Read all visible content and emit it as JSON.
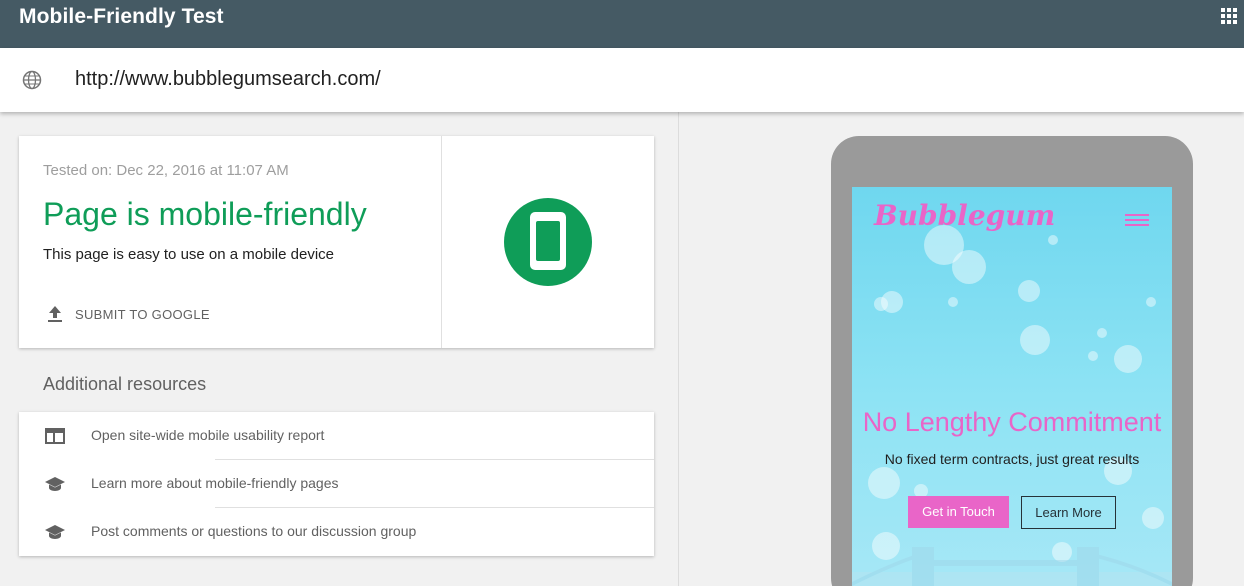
{
  "header": {
    "title": "Mobile-Friendly Test",
    "apps_icon": "apps-grid-icon"
  },
  "urlbar": {
    "icon": "globe-icon",
    "url": "http://www.bubblegumsearch.com/"
  },
  "result": {
    "tested_on": "Tested on: Dec 22, 2016 at 11:07 AM",
    "verdict": "Page is mobile-friendly",
    "subtitle": "This page is easy to use on a mobile device",
    "submit_label": "SUBMIT TO GOOGLE",
    "status_color": "#0f9d58",
    "badge_icon": "smartphone-icon"
  },
  "resources": {
    "title": "Additional resources",
    "items": [
      {
        "label": "Open site-wide mobile usability report",
        "icon": "web-layout-icon"
      },
      {
        "label": "Learn more about mobile-friendly pages",
        "icon": "school-icon"
      },
      {
        "label": "Post comments or questions to our discussion group",
        "icon": "school-icon"
      }
    ]
  },
  "preview": {
    "logo_text": "Bubblegum",
    "hero_title": "No Lengthy Commitment",
    "hero_subtitle": "No fixed term contracts, just great results",
    "button_primary": "Get in Touch",
    "button_secondary": "Learn More",
    "accent_color": "#e965c8"
  }
}
